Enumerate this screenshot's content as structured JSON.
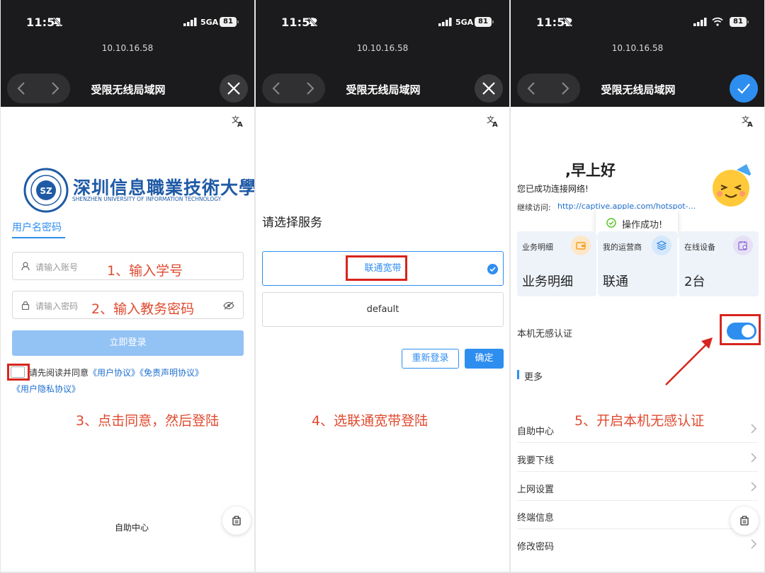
{
  "status_bar": [
    {
      "time": "11:51",
      "network": "5GA",
      "battery": "81"
    },
    {
      "time": "11:52",
      "network": "5GA",
      "battery": "81"
    },
    {
      "time": "11:52",
      "network": "",
      "battery": "81"
    }
  ],
  "browser": {
    "url": "10.10.16.58",
    "page_title": "受限无线局域网"
  },
  "panel1": {
    "logo_chinese": "深圳信息職業技術大學",
    "logo_english": "SHENZHEN UNIVERSITY OF INFORMATION TECHNOLOGY",
    "tab_label": "用户名密码",
    "account_placeholder": "请输入账号",
    "password_placeholder": "请输入密码",
    "login_button": "立即登录",
    "agree_prefix": "请先阅读并同意",
    "agree_link1": "《用户协议》",
    "agree_link2": "《免责声明协议》",
    "agree_link3": "《用户隐私协议》",
    "self_service": "自助中心",
    "annotation1": "1、输入学号",
    "annotation2": "2、输入教务密码",
    "annotation3": "3、点击同意，然后登陆"
  },
  "panel2": {
    "heading": "请选择服务",
    "option_selected": "联通宽带",
    "option_other": "default",
    "relogin_button": "重新登录",
    "confirm_button": "确定",
    "annotation4": "4、选联通宽带登陆"
  },
  "panel3": {
    "greeting": ",早上好",
    "connected_text": "您已成功连接网络!",
    "continue_label": "继续访问:",
    "continue_link": "http://captive.apple.com/hotspot-...",
    "toast": "操作成功!",
    "cards": [
      {
        "title": "业务明细",
        "value": "业务明细"
      },
      {
        "title": "我的运营商",
        "value": "联通"
      },
      {
        "title": "在线设备",
        "value": "2台"
      }
    ],
    "seamless_auth_label": "本机无感认证",
    "seamless_auth_on": true,
    "more_label": "更多",
    "menu": [
      "自助中心",
      "我要下线",
      "上网设置",
      "终端信息",
      "修改密码"
    ],
    "annotation5": "5、开启本机无感认证"
  },
  "colors": {
    "accent": "#2e8ef0",
    "annotation": "#e04a2f",
    "highlight_box": "#d8251d"
  }
}
